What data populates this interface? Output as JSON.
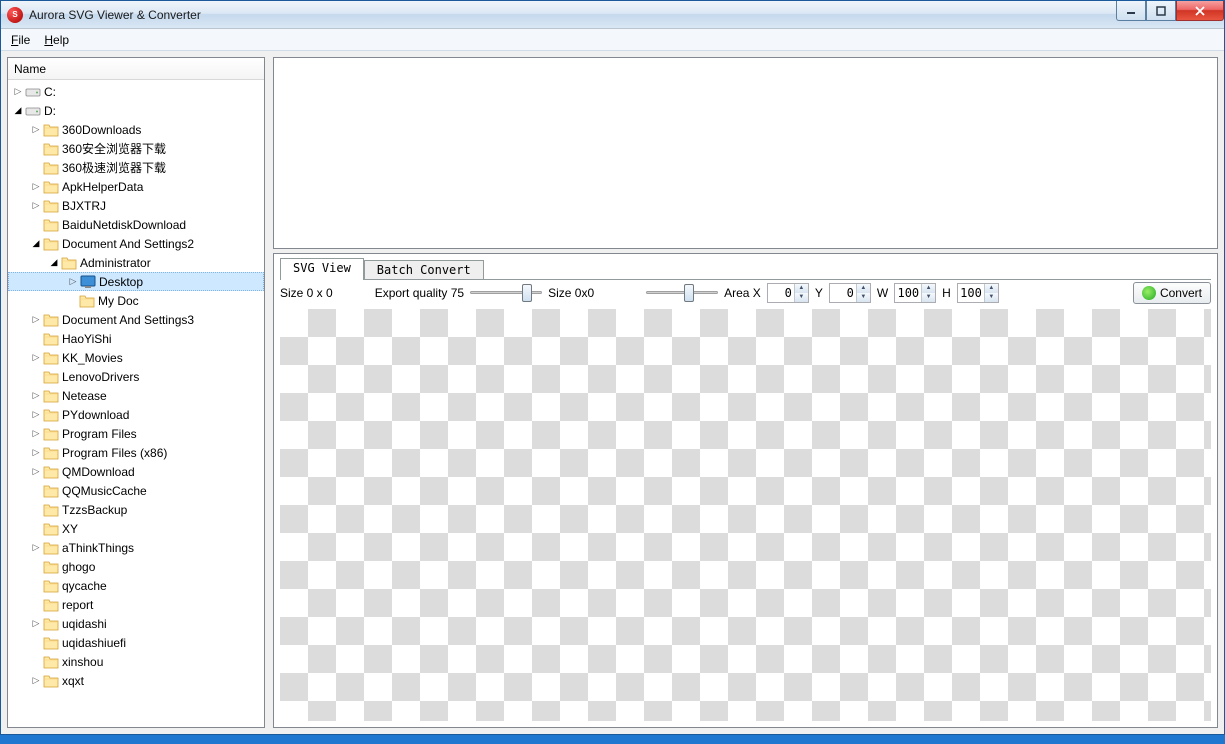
{
  "titlebar": {
    "title": "Aurora SVG Viewer & Converter"
  },
  "menu": {
    "file": "File",
    "help": "Help"
  },
  "tree": {
    "header": "Name",
    "c": "C:",
    "d": "D:",
    "items": [
      "360Downloads",
      "360安全浏览器下载",
      "360极速浏览器下载",
      "ApkHelperData",
      "BJXTRJ",
      "BaiduNetdiskDownload",
      "Document And Settings2",
      "Document And Settings3",
      "HaoYiShi",
      "KK_Movies",
      "LenovoDrivers",
      "Netease",
      "PYdownload",
      "Program Files",
      "Program Files (x86)",
      "QMDownload",
      "QQMusicCache",
      "TzzsBackup",
      "XY",
      "aThinkThings",
      "ghogo",
      "qycache",
      "report",
      "uqidashi",
      "uqidashiuefi",
      "xinshou",
      "xqxt"
    ],
    "admin": "Administrator",
    "desktop": "Desktop",
    "mydoc": "My Doc"
  },
  "tabs": {
    "svgview": "SVG View",
    "batch": "Batch Convert"
  },
  "controls": {
    "size": "Size 0 x 0",
    "exportq": "Export quality 75",
    "size2": "Size 0x0",
    "areax": "Area X",
    "y": "Y",
    "w": "W",
    "h": "H",
    "x_val": "0",
    "y_val": "0",
    "w_val": "100",
    "h_val": "100",
    "convert": "Convert"
  }
}
